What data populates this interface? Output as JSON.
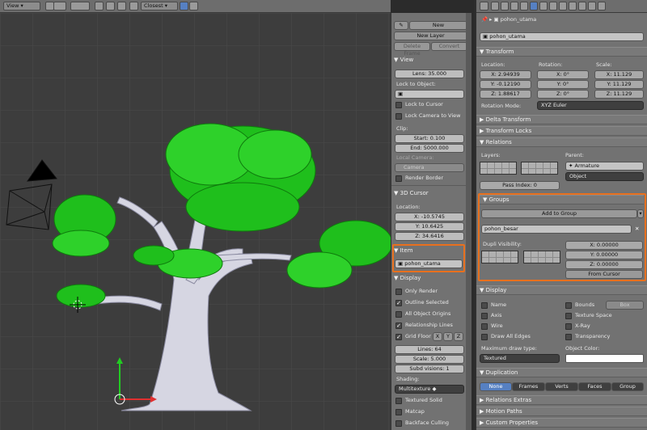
{
  "header": {
    "view_menu": "View",
    "pivot": "Closest"
  },
  "npanel": {
    "new_button": "New",
    "new_layer_button": "New Layer",
    "delete_frame_button": "Delete Frame",
    "convert_button": "Convert",
    "view_section": "View",
    "lens": "Lens: 35.000",
    "lock_to_object_label": "Lock to Object:",
    "lock_to_cursor": "Lock to Cursor",
    "lock_camera_to_view": "Lock Camera to View",
    "clip_label": "Clip:",
    "clip_start": "Start: 0.100",
    "clip_end": "End: 5000.000",
    "local_camera_label": "Local Camera:",
    "local_camera_value": "Camera",
    "render_border": "Render Border",
    "cursor_section": "3D Cursor",
    "location_label": "Location:",
    "cursor_x": "X: -10.5745",
    "cursor_y": "Y: 10.6425",
    "cursor_z": "Z: 34.6416",
    "item_section": "Item",
    "item_name": "pohon_utama",
    "display_section": "Display",
    "only_render": "Only Render",
    "outline_selected": "Outline Selected",
    "all_object_origins": "All Object Origins",
    "relationship_lines": "Relationship Lines",
    "grid_floor": "Grid Floor",
    "axis_x": "X",
    "axis_y": "Y",
    "axis_z": "Z",
    "lines": "Lines: 64",
    "scale": "Scale: 5.000",
    "subdivisions": "Subd visions: 1",
    "shading_label": "Shading:",
    "shading_value": "Multitexture",
    "textured_solid": "Textured Solid",
    "matcap": "Matcap",
    "backface_culling": "Backface Culling"
  },
  "props": {
    "object_name_top": "pohon_utama",
    "object_name": "pohon_utama",
    "transform_section": "Transform",
    "location_label": "Location:",
    "rotation_label": "Rotation:",
    "scale_label": "Scale:",
    "loc_x": "X: 2.94939",
    "loc_y": "Y: -0.12190",
    "loc_z": "Z: 1.88617",
    "rot_x": "X: 0°",
    "rot_y": "Y: 0°",
    "rot_z": "Z: 0°",
    "scale_x": "X: 11.129",
    "scale_y": "Y: 11.129",
    "scale_z": "Z: 11.129",
    "rotation_mode_label": "Rotation Mode:",
    "rotation_mode_value": "XYZ Euler",
    "delta_transform_section": "Delta Transform",
    "transform_locks_section": "Transform Locks",
    "relations_section": "Relations",
    "layers_label": "Layers:",
    "parent_label": "Parent:",
    "parent_value": "Armature",
    "parent_type": "Object",
    "pass_index": "Pass Index: 0",
    "groups_section": "Groups",
    "add_to_group": "Add to Group",
    "group_name": "pohon_besar",
    "dupli_visibility_label": "Dupli Visibility:",
    "dupli_x": "X: 0.00000",
    "dupli_y": "Y: 0.00000",
    "dupli_z": "Z: 0.00000",
    "from_cursor": "From Cursor",
    "display_section": "Display",
    "name": "Name",
    "axis": "Axis",
    "wire": "Wire",
    "draw_all_edges": "Draw All Edges",
    "bounds": "Bounds",
    "bounds_type": "Box",
    "texture_space": "Texture Space",
    "xray": "X-Ray",
    "transparency": "Transparency",
    "max_draw_type_label": "Maximum draw type:",
    "max_draw_type_value": "Textured",
    "object_color_label": "Object Color:",
    "duplication_section": "Duplication",
    "dup_none": "None",
    "dup_frames": "Frames",
    "dup_verts": "Verts",
    "dup_faces": "Faces",
    "dup_group": "Group",
    "relations_extras_section": "Relations Extras",
    "motion_paths_section": "Motion Paths",
    "custom_properties_section": "Custom Properties"
  },
  "colors": {
    "highlight": "#e8701e",
    "foliage": "#22c21f",
    "trunk": "#d8d8e4",
    "selected_tab": "#5680c2"
  }
}
